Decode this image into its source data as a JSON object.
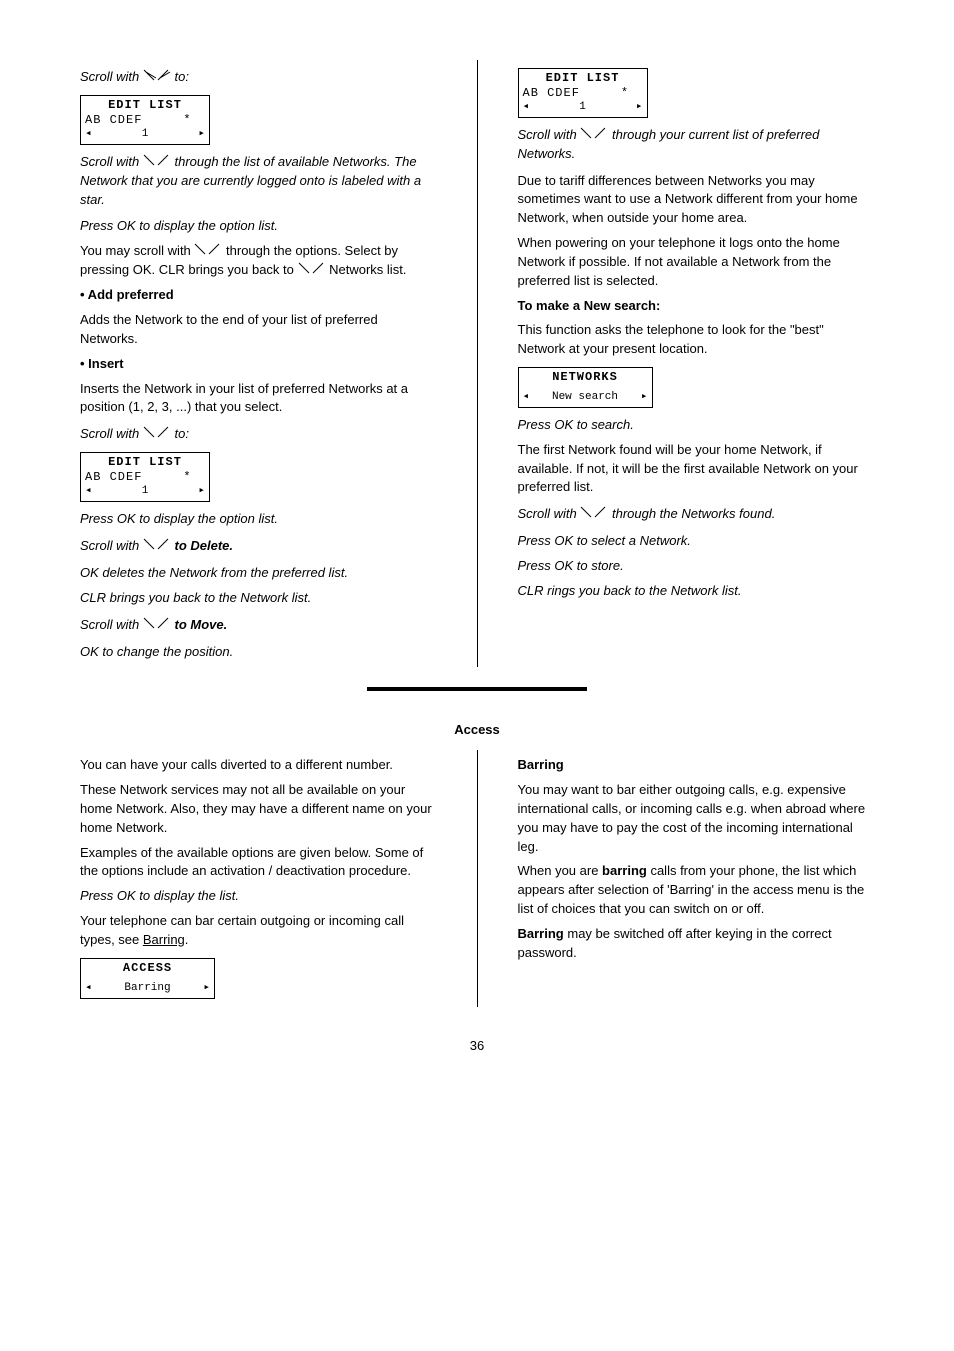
{
  "left1": {
    "scroll1_pre": "Scroll with ",
    "scroll1_post": " to:",
    "lcd": {
      "title": "EDIT LIST",
      "line2": "AB CDEF     *",
      "lnum": "1"
    },
    "scroll2": "Scroll with ",
    "scroll2_post": " through the list of available Networks. The Network that you are currently logged onto is labeled with a star.",
    "press_ok": "Press OK to display the option list.",
    "opt_line_pre": "You may scroll with ",
    "opt_line_mid": " through the options. Select by pressing OK. CLR brings you back to ",
    "opt_line_tail": " Networks list.",
    "add_h": "• Add preferred",
    "add_b": "Adds the Network to the end of your list of preferred Networks.",
    "ins_h": "• Insert",
    "ins_b": "Inserts the Network in your list of preferred Networks at a position (1, 2, 3, ...) that you select.",
    "scroll3_pre": "Scroll with ",
    "scroll3_post": " to:",
    "lcd2": {
      "title": "EDIT LIST",
      "line2": "AB CDEF     *",
      "lnum": "1"
    },
    "press_ok2": "Press OK to display the option list.",
    "sel_pre": "Scroll with ",
    "sel_post": " to Delete.",
    "ok_del": "OK deletes the Network from the preferred list.",
    "clr": "CLR brings you back to the Network list.",
    "sel_pre2": "Scroll with ",
    "sel_post2": " to Move.",
    "ok_move": "OK to change the position."
  },
  "right1": {
    "lcd": {
      "title": "EDIT LIST",
      "line2": "AB CDEF     *",
      "lnum": "1"
    },
    "scroll_pre": "Scroll with ",
    "scroll_post": " through your current list of preferred Networks.",
    "note1": "Due to tariff differences between Networks you may sometimes want to use a Network different from your home Network, when outside your home area.",
    "note2": "When powering on your telephone it logs onto the home Network if possible. If not available a Network from the preferred list is selected.",
    "new_h": "To make a New search:",
    "new_b": "This function asks the telephone to look for the \"best\" Network at your present location.",
    "lcd_net": {
      "title": "NETWORKS",
      "line2": "New search"
    },
    "ok": "Press OK to search.",
    "found": "The first Network found will be your home Network, if available. If not, it will be the first available Network on your preferred list.",
    "sel_pre": "Scroll with ",
    "sel_post": " through the Networks found.",
    "ok2": "Press OK to select a Network.",
    "ok3": "Press OK to store.",
    "clr": "CLR rings you back to the Network list."
  },
  "access": {
    "title": "Access",
    "p1": "You can have your calls diverted to a different number.",
    "p2": "These Network services may not all be available on your home Network. Also, they may have a different name on your home Network.",
    "p3": "Examples of the available options are given below. Some of the options include an activation / deactivation procedure.",
    "ok1": "Press OK to display the list.",
    "p4_pre": "Your telephone can bar certain outgoing or incoming call types, see ",
    "p4_link": "Barring",
    "p4_post": ".",
    "lcd": {
      "title": "ACCESS",
      "line2": "Barring"
    },
    "bar_h": "Barring",
    "bar1": "You may want to bar either outgoing calls, e.g. expensive international calls, or incoming calls e.g. when abroad where you may have to pay the cost of the incoming international leg.",
    "bar2_a": "When you are ",
    "bar2_b": "barring",
    "bar2_c": " calls from your phone, the list which appears after selection of 'Barring' in the access menu is the list of choices that you can switch on or off.",
    "bar3_a": "Barring",
    "bar3_b": " may be switched off after keying in the correct password."
  },
  "page": "36"
}
